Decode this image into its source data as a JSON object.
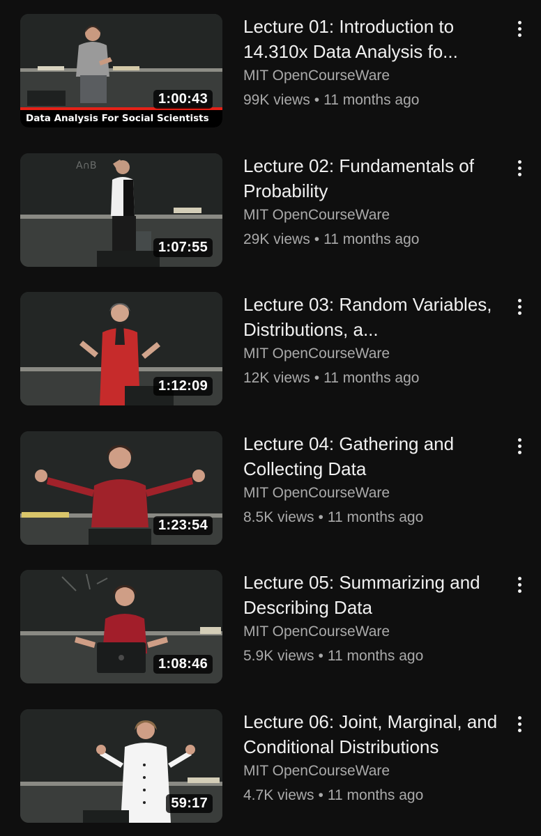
{
  "colors": {
    "background": "#0f0f0f",
    "title": "#f1f1f1",
    "secondary": "#aaaaaa",
    "progress": "#e62117"
  },
  "videos": [
    {
      "title": "Lecture 01: Introduction to 14.310x Data Analysis fo...",
      "channel": "MIT OpenCourseWare",
      "views": "99K views",
      "age": "11 months ago",
      "duration": "1:00:43",
      "thumbnail_caption": "Data Analysis For Social Scientists",
      "watched_fraction": 1.0,
      "menu_icon": "more-vert-icon"
    },
    {
      "title": "Lecture 02: Fundamentals of Probability",
      "channel": "MIT OpenCourseWare",
      "views": "29K views",
      "age": "11 months ago",
      "duration": "1:07:55",
      "menu_icon": "more-vert-icon"
    },
    {
      "title": "Lecture 03: Random Variables, Distributions, a...",
      "channel": "MIT OpenCourseWare",
      "views": "12K views",
      "age": "11 months ago",
      "duration": "1:12:09",
      "menu_icon": "more-vert-icon"
    },
    {
      "title": "Lecture 04: Gathering and Collecting Data",
      "channel": "MIT OpenCourseWare",
      "views": "8.5K views",
      "age": "11 months ago",
      "duration": "1:23:54",
      "menu_icon": "more-vert-icon"
    },
    {
      "title": "Lecture 05: Summarizing and Describing Data",
      "channel": "MIT OpenCourseWare",
      "views": "5.9K views",
      "age": "11 months ago",
      "duration": "1:08:46",
      "menu_icon": "more-vert-icon"
    },
    {
      "title": "Lecture 06: Joint, Marginal, and Conditional Distributions",
      "channel": "MIT OpenCourseWare",
      "views": "4.7K views",
      "age": "11 months ago",
      "duration": "59:17",
      "menu_icon": "more-vert-icon"
    }
  ]
}
